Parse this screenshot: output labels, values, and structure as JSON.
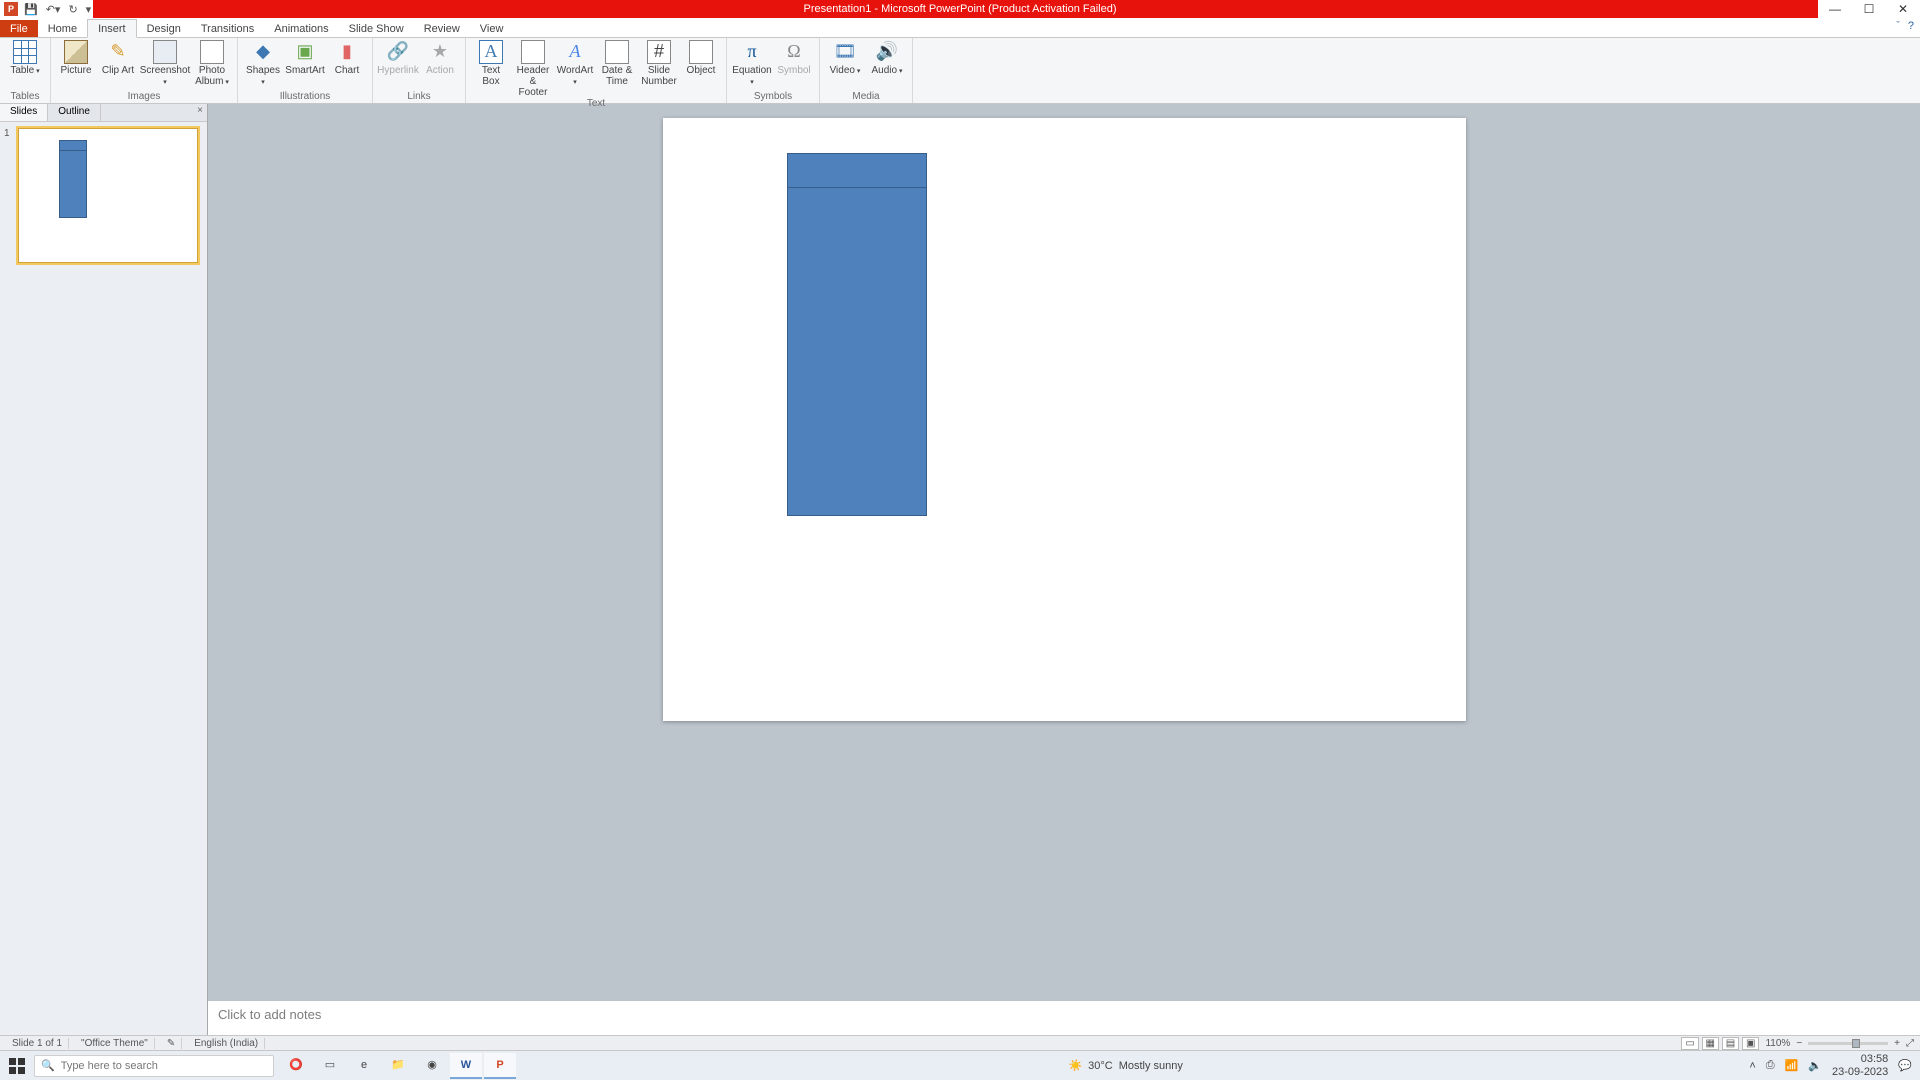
{
  "titlebar": {
    "title": "Presentation1 - Microsoft PowerPoint (Product Activation Failed)"
  },
  "ribbon_tabs": {
    "file": "File",
    "items": [
      "Home",
      "Insert",
      "Design",
      "Transitions",
      "Animations",
      "Slide Show",
      "Review",
      "View"
    ],
    "active_index": 1
  },
  "ribbon_groups": {
    "tables": {
      "label": "Tables",
      "table": "Table"
    },
    "images": {
      "label": "Images",
      "picture": "Picture",
      "clipart": "Clip\nArt",
      "screenshot": "Screenshot",
      "photo": "Photo\nAlbum"
    },
    "illus": {
      "label": "Illustrations",
      "shapes": "Shapes",
      "smartart": "SmartArt",
      "chart": "Chart"
    },
    "links": {
      "label": "Links",
      "hyper": "Hyperlink",
      "action": "Action"
    },
    "text": {
      "label": "Text",
      "tb": "Text\nBox",
      "hf": "Header\n& Footer",
      "wa": "WordArt",
      "dt": "Date\n& Time",
      "sn": "Slide\nNumber",
      "obj": "Object"
    },
    "symbols": {
      "label": "Symbols",
      "eq": "Equation",
      "sym": "Symbol"
    },
    "media": {
      "label": "Media",
      "video": "Video",
      "audio": "Audio"
    }
  },
  "sidepanel": {
    "tab_slides": "Slides",
    "tab_outline": "Outline",
    "thumb_number": "1"
  },
  "slide_shape": {
    "fill": "#4f81bd",
    "border": "#385d8a"
  },
  "notes": {
    "placeholder": "Click to add notes"
  },
  "statusbar": {
    "slide": "Slide 1 of 1",
    "theme": "\"Office Theme\"",
    "lang": "English (India)",
    "zoom": "110%"
  },
  "taskbar": {
    "search_placeholder": "Type here to search",
    "weather_temp": "30°C",
    "weather_desc": "Mostly sunny",
    "time": "03:58",
    "date": "23-09-2023"
  }
}
